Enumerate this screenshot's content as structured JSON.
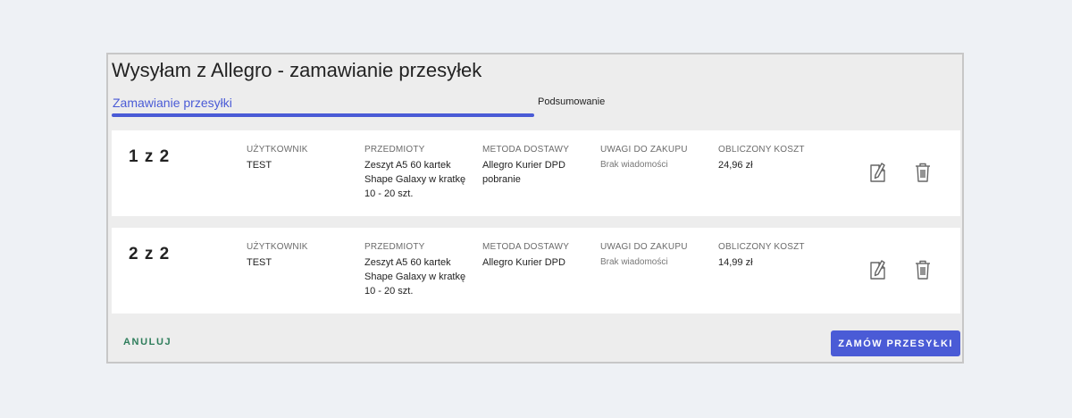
{
  "dialog": {
    "title": "Wysyłam z Allegro - zamawianie przesyłek"
  },
  "tabs": {
    "active_label": "Zamawianie przesyłki",
    "summary_label": "Podsumowanie"
  },
  "columns": {
    "user": "UŻYTKOWNIK",
    "items": "PRZEDMIOTY",
    "delivery": "METODA DOSTAWY",
    "notes": "UWAGI DO ZAKUPU",
    "cost": "OBLICZONY KOSZT"
  },
  "shipments": [
    {
      "index": "1 z 2",
      "user": "TEST",
      "items": "Zeszyt A5 60 kartek\nShape Galaxy w kratkę\n10 - 20 szt.",
      "delivery": "Allegro Kurier DPD\npobranie",
      "notes": "Brak wiadomości",
      "cost": "24,96 zł"
    },
    {
      "index": "2 z 2",
      "user": "TEST",
      "items": "Zeszyt A5 60 kartek\nShape Galaxy w kratkę\n10 - 20 szt.",
      "delivery": "Allegro Kurier DPD",
      "notes": "Brak wiadomości",
      "cost": "14,99 zł"
    }
  ],
  "icons": {
    "edit": "edit-note-icon",
    "delete": "trash-icon"
  },
  "footer": {
    "cancel_label": "ANULUJ",
    "order_label": "ZAMÓW PRZESYŁKI"
  },
  "colors": {
    "accent": "#4a5bd6",
    "cancel": "#2e7d5b"
  }
}
